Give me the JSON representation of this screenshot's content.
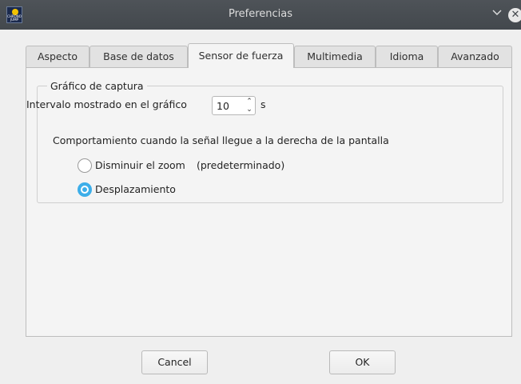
{
  "window": {
    "title": "Preferencias",
    "icon_text": "CHRONO JUMP"
  },
  "tabs": [
    {
      "label": "Aspecto",
      "active": false
    },
    {
      "label": "Base de datos",
      "active": false
    },
    {
      "label": "Sensor de fuerza",
      "active": true
    },
    {
      "label": "Multimedia",
      "active": false
    },
    {
      "label": "Idioma",
      "active": false
    },
    {
      "label": "Avanzado",
      "active": false
    }
  ],
  "capture_group": {
    "title": "Gráfico de captura",
    "interval_label": "Intervalo mostrado en el gráfico",
    "interval_value": "10",
    "interval_unit": "s",
    "behavior_label": "Comportamiento cuando la señal llegue a la derecha de la pantalla",
    "options": [
      {
        "label": "Disminuir el zoom",
        "note": "(predeterminado)",
        "checked": false
      },
      {
        "label": "Desplazamiento",
        "note": "",
        "checked": true
      }
    ]
  },
  "buttons": {
    "cancel": "Cancel",
    "ok": "OK"
  },
  "colors": {
    "accent": "#3daee9",
    "titlebar": "#474c51"
  }
}
